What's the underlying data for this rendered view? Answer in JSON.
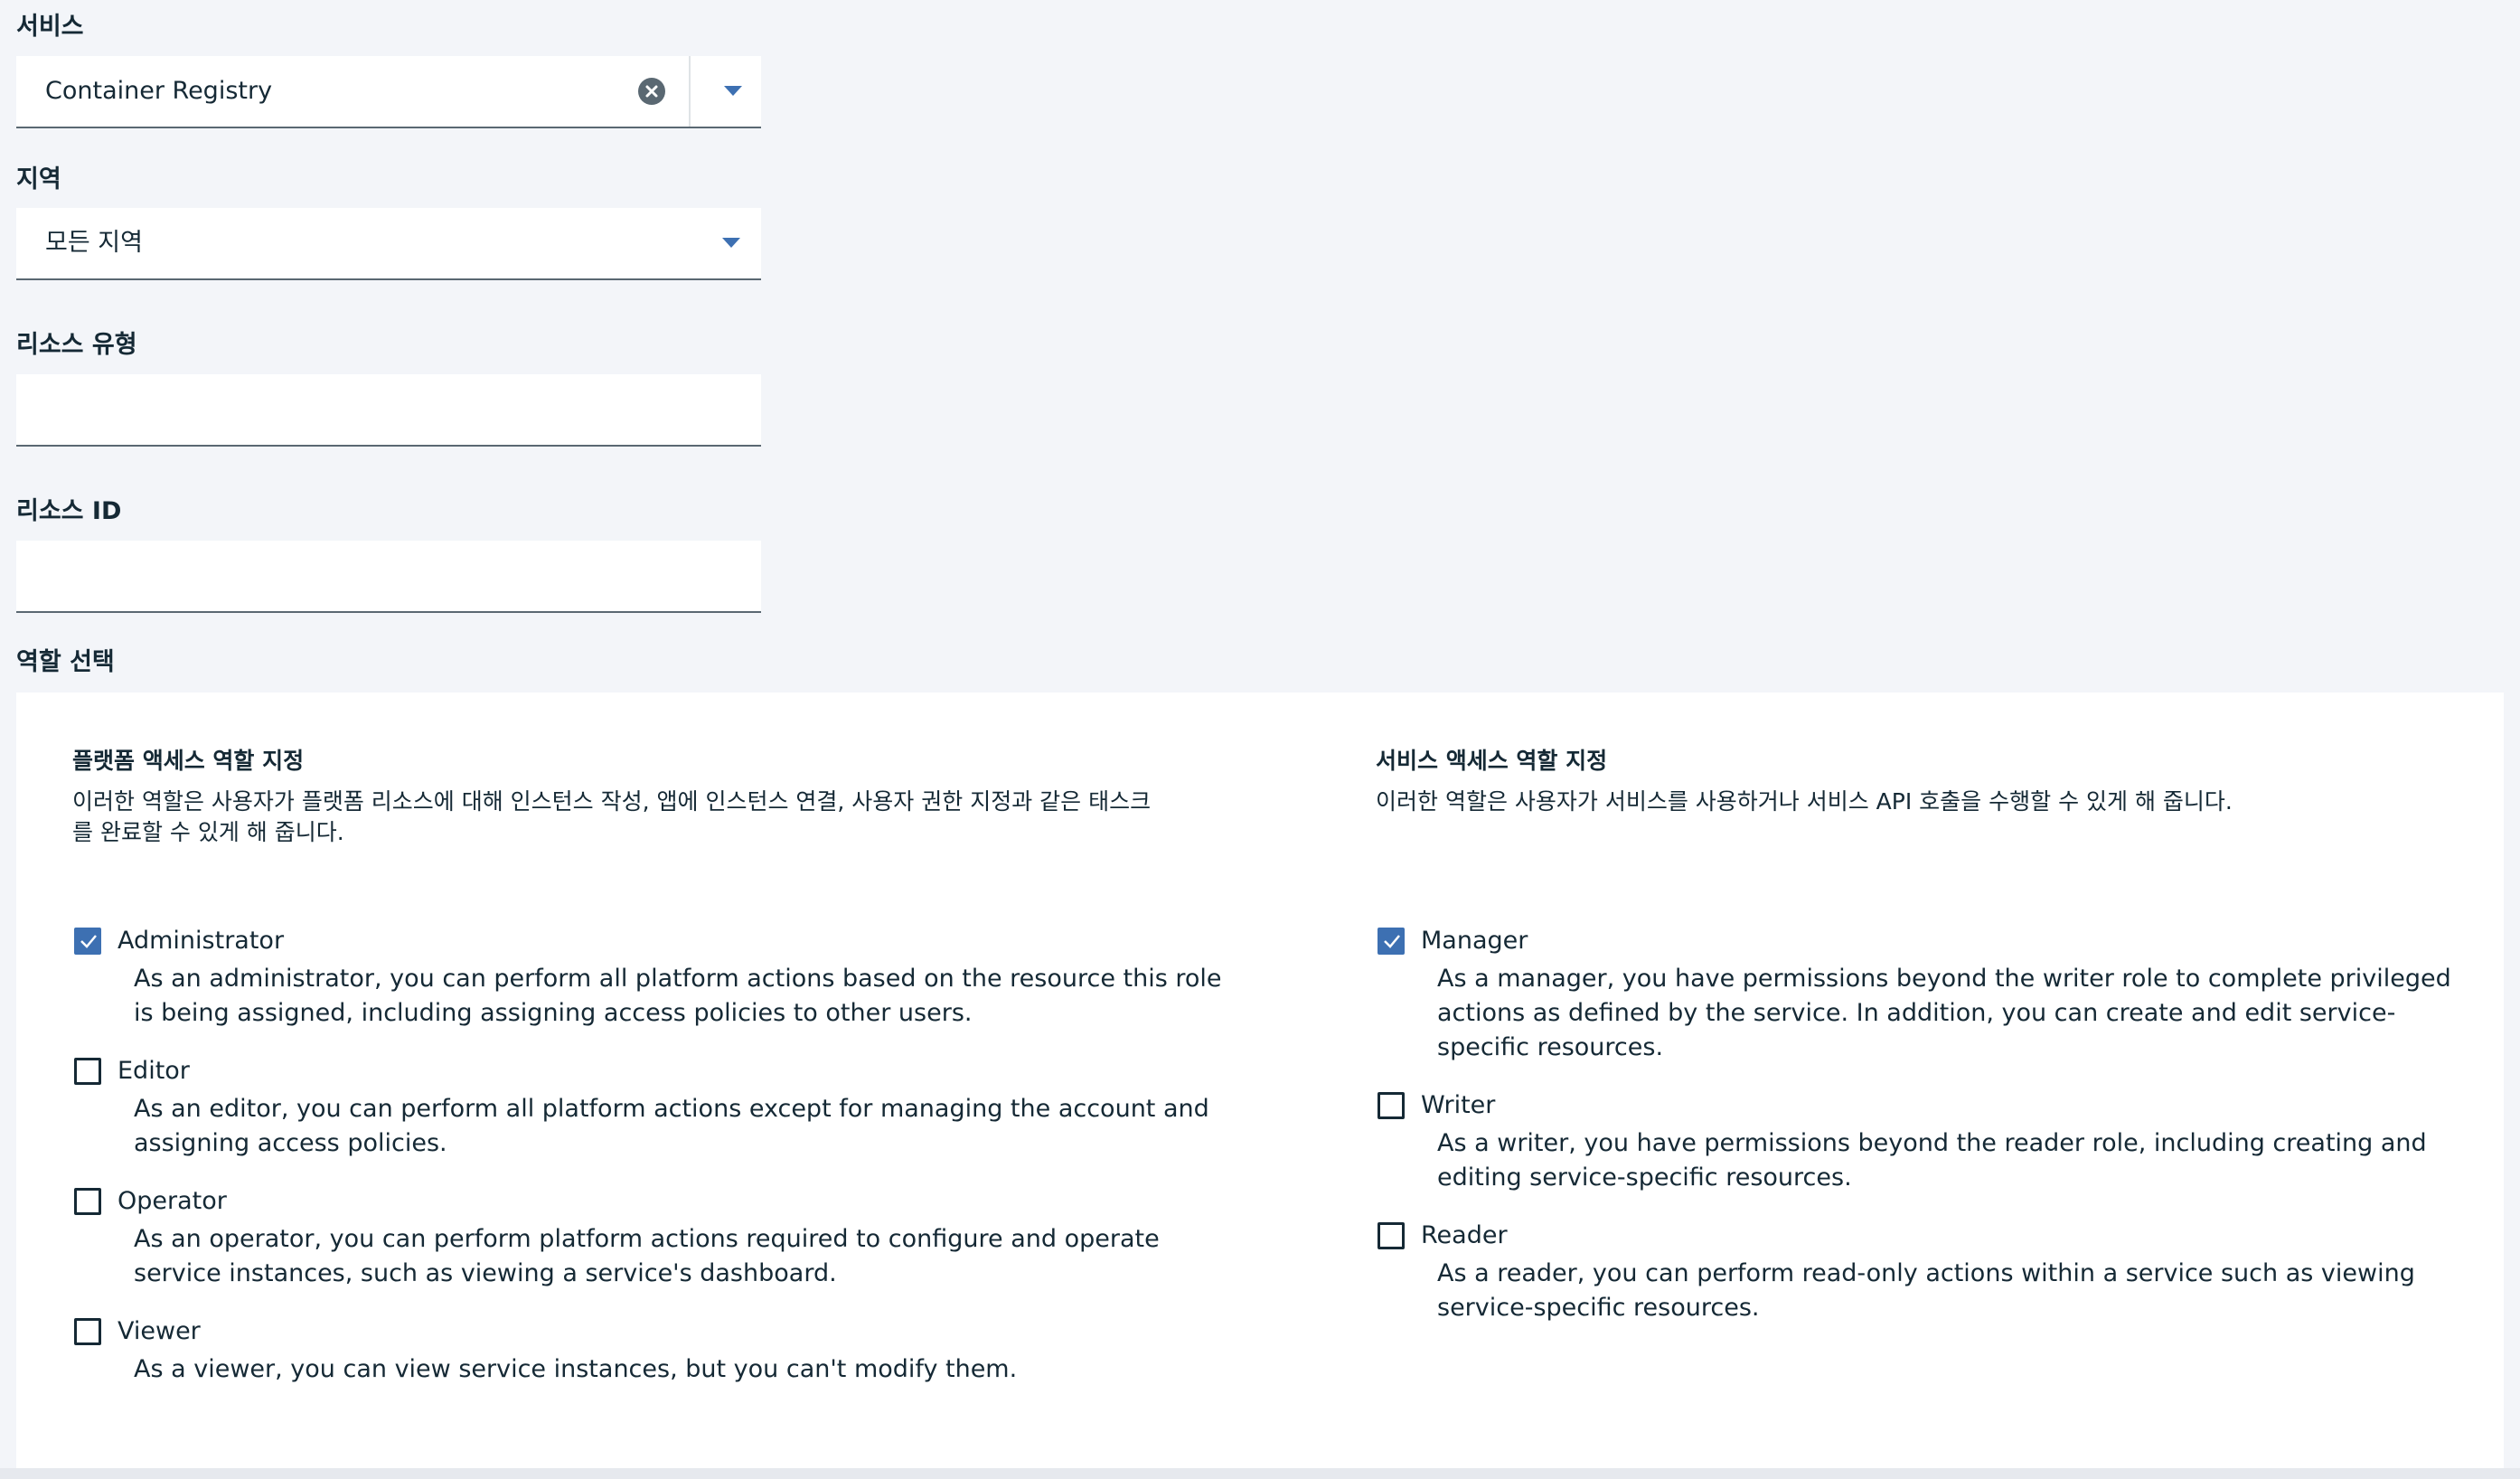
{
  "fields": {
    "service": {
      "label": "서비스",
      "value": "Container Registry"
    },
    "region": {
      "label": "지역",
      "value": "모든 지역"
    },
    "resource_type": {
      "label": "리소스 유형",
      "value": ""
    },
    "resource_id": {
      "label": "리소스 ID",
      "value": ""
    }
  },
  "roles_section": {
    "label": "역할 선택",
    "platform": {
      "title": "플랫폼 액세스 역할 지정",
      "description": "이러한 역할은 사용자가 플랫폼 리소스에 대해 인스턴스 작성, 앱에 인스턴스 연결, 사용자 권한 지정과 같은 태스크를 완료할 수 있게 해 줍니다.",
      "roles": [
        {
          "name": "Administrator",
          "checked": true,
          "description": "As an administrator, you can perform all platform actions based on the resource this role is being assigned, including assigning access policies to other users."
        },
        {
          "name": "Editor",
          "checked": false,
          "description": "As an editor, you can perform all platform actions except for managing the account and assigning access policies."
        },
        {
          "name": "Operator",
          "checked": false,
          "description": "As an operator, you can perform platform actions required to configure and operate service instances, such as viewing a service's dashboard."
        },
        {
          "name": "Viewer",
          "checked": false,
          "description": "As a viewer, you can view service instances, but you can't modify them."
        }
      ]
    },
    "service": {
      "title": "서비스 액세스 역할 지정",
      "description": "이러한 역할은 사용자가 서비스를 사용하거나 서비스 API 호출을 수행할 수 있게 해 줍니다.",
      "roles": [
        {
          "name": "Manager",
          "checked": true,
          "description": "As a manager, you have permissions beyond the writer role to complete privileged actions as defined by the service. In addition, you can create and edit service-specific resources."
        },
        {
          "name": "Writer",
          "checked": false,
          "description": "As a writer, you have permissions beyond the reader role, including creating and editing service-specific resources."
        },
        {
          "name": "Reader",
          "checked": false,
          "description": "As a reader, you can perform read-only actions within a service such as viewing service-specific resources."
        }
      ]
    }
  },
  "colors": {
    "accent": "#3d70b2",
    "text": "#152935",
    "page_bg": "#f3f5f9",
    "field_bg": "#ffffff"
  }
}
